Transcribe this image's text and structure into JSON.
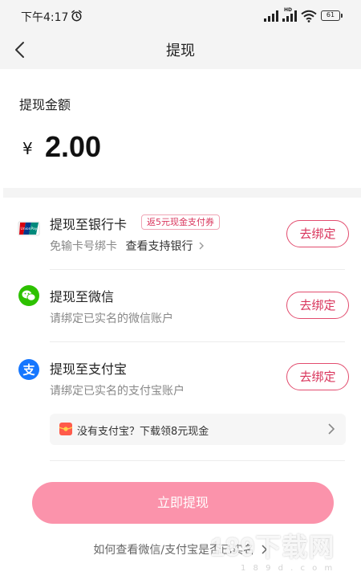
{
  "status_bar": {
    "time": "下午4:17",
    "network_label": "HD",
    "battery": "61",
    "icons": [
      "alarm-icon",
      "signal-icon",
      "signal-hd-icon",
      "wifi-icon",
      "battery-icon"
    ]
  },
  "nav": {
    "title": "提现",
    "back_icon": "chevron-left-icon"
  },
  "amount": {
    "label": "提现金额",
    "currency": "¥",
    "value": "2.00"
  },
  "options": [
    {
      "title": "提现至银行卡",
      "promo": "返5元现金支付券",
      "sub_prefix": "免输卡号绑卡",
      "sub_link": "查看支持银行",
      "button": "去绑定",
      "icon": "unionpay-icon"
    },
    {
      "title": "提现至微信",
      "sub": "请绑定已实名的微信账户",
      "button": "去绑定",
      "icon": "wechat-icon"
    },
    {
      "title": "提现至支付宝",
      "sub": "请绑定已实名的支付宝账户",
      "button": "去绑定",
      "icon": "alipay-icon"
    }
  ],
  "alipay_banner": {
    "text": "没有支付宝？下载领8元现金",
    "icon": "red-packet-icon"
  },
  "submit": {
    "label": "立即提现"
  },
  "help": {
    "text": "如何查看微信/支付宝是否已实名"
  },
  "watermark": {
    "text": "189下载网",
    "sub": "1 8 9 d . c o m"
  },
  "colors": {
    "accent": "#d9355c",
    "submit_bg": "#fb93ab",
    "page_bg": "#f4f4f4",
    "wechat": "#2dc100",
    "alipay": "#1677ff"
  }
}
